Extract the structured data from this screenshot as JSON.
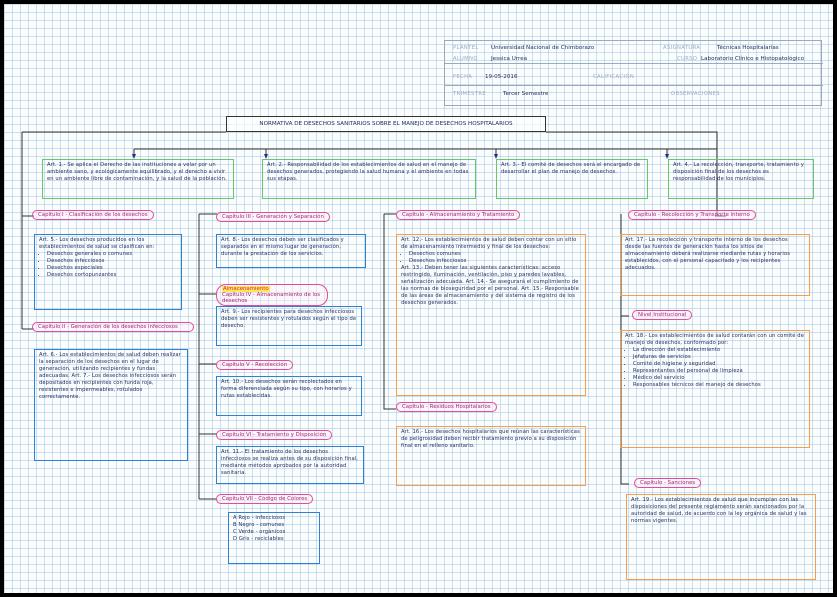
{
  "header": {
    "plantel_label": "PLANTEL",
    "plantel_value": "Universidad Nacional de Chimborazo",
    "asignatura_label": "ASIGNATURA",
    "asignatura_value": "Técnicas Hospitalarias",
    "alumno_label": "ALUMNO",
    "alumno_value": "Jessica Urrea",
    "curso_label": "CURSO",
    "curso_value": "Laboratorio Clínico e Histopatológico",
    "fecha_label": "FECHA",
    "fecha_value": "19-05-2016",
    "calificacion_label": "CALIFICACIÓN",
    "trimestre_label": "TRIMESTRE",
    "trimestre_value": "Tercer Semestre",
    "observaciones_label": "OBSERVACIONES"
  },
  "title": "NORMATIVA DE DESECHOS SANITARIOS SOBRE EL MANEJO DE DESECHOS HOSPITALARIOS",
  "articles_top": [
    "Art. 1.- Se aplica el Derecho de las instituciones a velar por un ambiente sano, y ecológicamente equilibrado, y el derecho a vivir en un ambiente libre de contaminación, y la salud de la población.",
    "Art. 2.- Responsabilidad de los establecimientos de salud en el manejo de desechos generados, protegiendo la salud humana y el ambiente en todas sus etapas.",
    "Art. 3.- El comité de desechos será el encargado de desarrollar el plan de manejo de desechos.",
    "Art. 4.- La recolección, transporte, tratamiento y disposición final de los desechos es responsabilidad de los municipios."
  ],
  "sections": {
    "clasificacion": {
      "title": "Capítulo I - Clasificación de los desechos",
      "text": "Art. 5.- Los desechos producidos en los establecimientos de salud se clasifican en:",
      "items": [
        "Desechos generales o comunes",
        "Desechos infecciosos",
        "Desechos especiales",
        "Desechos cortopunzantes"
      ]
    },
    "infecciosos": {
      "title": "Capítulo II - Generación de los desechos infecciosos",
      "text": "Art. 6.- Los establecimientos de salud deben realizar la separación de los desechos en el lugar de generación, utilizando recipientes y fundas adecuadas. Art. 7.- Los desechos infecciosos serán depositados en recipientes con funda roja, resistentes e impermeables, rotulados correctamente."
    },
    "generacion": {
      "title": "Capítulo III - Generación y Separación",
      "text": "Art. 8.- Los desechos deben ser clasificados y separados en el mismo lugar de generación, durante la prestación de los servicios."
    },
    "almacenamiento": {
      "highlight": "Almacenamiento",
      "title": "Capítulo IV - Almacenamiento de los desechos",
      "text": "Art. 9.- Los recipientes para desechos infecciosos deben ser resistentes y rotulados según el tipo de desecho."
    },
    "recoleccion": {
      "title": "Capítulo V - Recolección",
      "text": "Art. 10.- Los desechos serán recolectados en forma diferenciada según su tipo, con horarios y rutas establecidas."
    },
    "tratamiento": {
      "title": "Capítulo VI - Tratamiento y Disposición",
      "text": "Art. 11.- El tratamiento de los desechos infecciosos se realiza antes de su disposición final, mediante métodos aprobados por la autoridad sanitaria."
    },
    "colores": {
      "title": "Capítulo VII - Código de Colores",
      "items": [
        "A   Rojo - infecciosos",
        "B   Negro - comunes",
        "C   Verde - orgánicos",
        "D   Gris - reciclables"
      ]
    },
    "almac_central": {
      "title": "Capítulo - Almacenamiento y Tratamiento",
      "text": "Art. 12.- Los establecimientos de salud deben contar con un sitio de almacenamiento intermedio y final de los desechos:",
      "items": [
        "Desechos comunes",
        "Desechos infecciosos"
      ],
      "text2": "Art. 13.- Deben tener las siguientes características: acceso restringido, iluminación, ventilación, piso y paredes lavables, señalización adecuada. Art. 14.- Se asegurará el cumplimiento de las normas de bioseguridad por el personal. Art. 15.- Responsable de las áreas de almacenamiento y del sistema de registro de los desechos generados."
    },
    "residuos": {
      "title": "Capítulo - Residuos Hospitalarios",
      "text": "Art. 16.- Los desechos hospitalarios que reúnan las características de peligrosidad deben recibir tratamiento previo a su disposición final en el relleno sanitario."
    },
    "recoleccion2": {
      "title": "Capítulo - Recolección y Transporte interno",
      "text": "Art. 17.- La recolección y transporte interno de los desechos desde las fuentes de generación hasta los sitios de almacenamiento deberá realizarse mediante rutas y horarios establecidos, con el personal capacitado y los recipientes adecuados."
    },
    "institucional": {
      "title": "Nivel Institucional",
      "text": "Art. 18.- Los establecimientos de salud contarán con un comité de manejo de desechos, conformado por:",
      "items": [
        "La dirección del establecimiento",
        "Jefaturas de servicios",
        "Comité de higiene y seguridad",
        "Representantes del personal de limpieza",
        "Médico del servicio",
        "Responsables técnicos del manejo de desechos"
      ]
    },
    "sanciones": {
      "title": "Capítulo - Sanciones",
      "text": "Art. 19.- Los establecimientos de salud que incumplan con las disposiciones del presente reglamento serán sancionados por la autoridad de salud, de acuerdo con la ley orgánica de salud y las normas vigentes."
    }
  }
}
